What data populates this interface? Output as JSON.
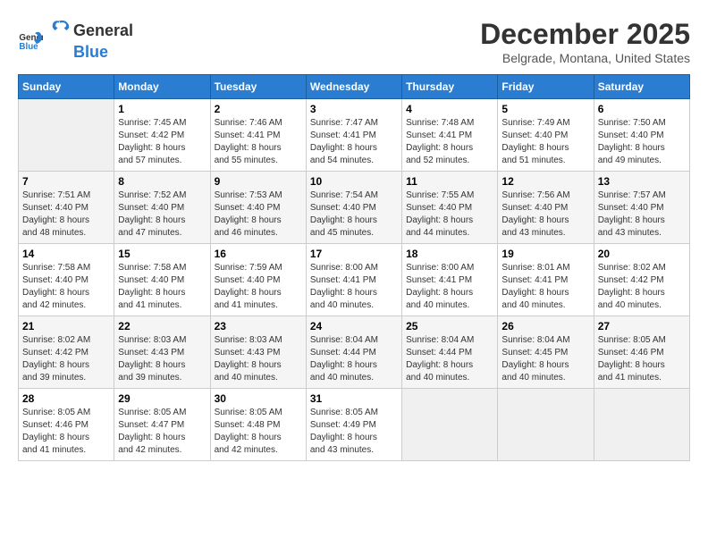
{
  "header": {
    "logo_general": "General",
    "logo_blue": "Blue",
    "month_title": "December 2025",
    "location": "Belgrade, Montana, United States"
  },
  "weekdays": [
    "Sunday",
    "Monday",
    "Tuesday",
    "Wednesday",
    "Thursday",
    "Friday",
    "Saturday"
  ],
  "weeks": [
    [
      {
        "day": "",
        "sunrise": "",
        "sunset": "",
        "daylight": ""
      },
      {
        "day": "1",
        "sunrise": "Sunrise: 7:45 AM",
        "sunset": "Sunset: 4:42 PM",
        "daylight": "Daylight: 8 hours and 57 minutes."
      },
      {
        "day": "2",
        "sunrise": "Sunrise: 7:46 AM",
        "sunset": "Sunset: 4:41 PM",
        "daylight": "Daylight: 8 hours and 55 minutes."
      },
      {
        "day": "3",
        "sunrise": "Sunrise: 7:47 AM",
        "sunset": "Sunset: 4:41 PM",
        "daylight": "Daylight: 8 hours and 54 minutes."
      },
      {
        "day": "4",
        "sunrise": "Sunrise: 7:48 AM",
        "sunset": "Sunset: 4:41 PM",
        "daylight": "Daylight: 8 hours and 52 minutes."
      },
      {
        "day": "5",
        "sunrise": "Sunrise: 7:49 AM",
        "sunset": "Sunset: 4:40 PM",
        "daylight": "Daylight: 8 hours and 51 minutes."
      },
      {
        "day": "6",
        "sunrise": "Sunrise: 7:50 AM",
        "sunset": "Sunset: 4:40 PM",
        "daylight": "Daylight: 8 hours and 49 minutes."
      }
    ],
    [
      {
        "day": "7",
        "sunrise": "Sunrise: 7:51 AM",
        "sunset": "Sunset: 4:40 PM",
        "daylight": "Daylight: 8 hours and 48 minutes."
      },
      {
        "day": "8",
        "sunrise": "Sunrise: 7:52 AM",
        "sunset": "Sunset: 4:40 PM",
        "daylight": "Daylight: 8 hours and 47 minutes."
      },
      {
        "day": "9",
        "sunrise": "Sunrise: 7:53 AM",
        "sunset": "Sunset: 4:40 PM",
        "daylight": "Daylight: 8 hours and 46 minutes."
      },
      {
        "day": "10",
        "sunrise": "Sunrise: 7:54 AM",
        "sunset": "Sunset: 4:40 PM",
        "daylight": "Daylight: 8 hours and 45 minutes."
      },
      {
        "day": "11",
        "sunrise": "Sunrise: 7:55 AM",
        "sunset": "Sunset: 4:40 PM",
        "daylight": "Daylight: 8 hours and 44 minutes."
      },
      {
        "day": "12",
        "sunrise": "Sunrise: 7:56 AM",
        "sunset": "Sunset: 4:40 PM",
        "daylight": "Daylight: 8 hours and 43 minutes."
      },
      {
        "day": "13",
        "sunrise": "Sunrise: 7:57 AM",
        "sunset": "Sunset: 4:40 PM",
        "daylight": "Daylight: 8 hours and 43 minutes."
      }
    ],
    [
      {
        "day": "14",
        "sunrise": "Sunrise: 7:58 AM",
        "sunset": "Sunset: 4:40 PM",
        "daylight": "Daylight: 8 hours and 42 minutes."
      },
      {
        "day": "15",
        "sunrise": "Sunrise: 7:58 AM",
        "sunset": "Sunset: 4:40 PM",
        "daylight": "Daylight: 8 hours and 41 minutes."
      },
      {
        "day": "16",
        "sunrise": "Sunrise: 7:59 AM",
        "sunset": "Sunset: 4:40 PM",
        "daylight": "Daylight: 8 hours and 41 minutes."
      },
      {
        "day": "17",
        "sunrise": "Sunrise: 8:00 AM",
        "sunset": "Sunset: 4:41 PM",
        "daylight": "Daylight: 8 hours and 40 minutes."
      },
      {
        "day": "18",
        "sunrise": "Sunrise: 8:00 AM",
        "sunset": "Sunset: 4:41 PM",
        "daylight": "Daylight: 8 hours and 40 minutes."
      },
      {
        "day": "19",
        "sunrise": "Sunrise: 8:01 AM",
        "sunset": "Sunset: 4:41 PM",
        "daylight": "Daylight: 8 hours and 40 minutes."
      },
      {
        "day": "20",
        "sunrise": "Sunrise: 8:02 AM",
        "sunset": "Sunset: 4:42 PM",
        "daylight": "Daylight: 8 hours and 40 minutes."
      }
    ],
    [
      {
        "day": "21",
        "sunrise": "Sunrise: 8:02 AM",
        "sunset": "Sunset: 4:42 PM",
        "daylight": "Daylight: 8 hours and 39 minutes."
      },
      {
        "day": "22",
        "sunrise": "Sunrise: 8:03 AM",
        "sunset": "Sunset: 4:43 PM",
        "daylight": "Daylight: 8 hours and 39 minutes."
      },
      {
        "day": "23",
        "sunrise": "Sunrise: 8:03 AM",
        "sunset": "Sunset: 4:43 PM",
        "daylight": "Daylight: 8 hours and 40 minutes."
      },
      {
        "day": "24",
        "sunrise": "Sunrise: 8:04 AM",
        "sunset": "Sunset: 4:44 PM",
        "daylight": "Daylight: 8 hours and 40 minutes."
      },
      {
        "day": "25",
        "sunrise": "Sunrise: 8:04 AM",
        "sunset": "Sunset: 4:44 PM",
        "daylight": "Daylight: 8 hours and 40 minutes."
      },
      {
        "day": "26",
        "sunrise": "Sunrise: 8:04 AM",
        "sunset": "Sunset: 4:45 PM",
        "daylight": "Daylight: 8 hours and 40 minutes."
      },
      {
        "day": "27",
        "sunrise": "Sunrise: 8:05 AM",
        "sunset": "Sunset: 4:46 PM",
        "daylight": "Daylight: 8 hours and 41 minutes."
      }
    ],
    [
      {
        "day": "28",
        "sunrise": "Sunrise: 8:05 AM",
        "sunset": "Sunset: 4:46 PM",
        "daylight": "Daylight: 8 hours and 41 minutes."
      },
      {
        "day": "29",
        "sunrise": "Sunrise: 8:05 AM",
        "sunset": "Sunset: 4:47 PM",
        "daylight": "Daylight: 8 hours and 42 minutes."
      },
      {
        "day": "30",
        "sunrise": "Sunrise: 8:05 AM",
        "sunset": "Sunset: 4:48 PM",
        "daylight": "Daylight: 8 hours and 42 minutes."
      },
      {
        "day": "31",
        "sunrise": "Sunrise: 8:05 AM",
        "sunset": "Sunset: 4:49 PM",
        "daylight": "Daylight: 8 hours and 43 minutes."
      },
      {
        "day": "",
        "sunrise": "",
        "sunset": "",
        "daylight": ""
      },
      {
        "day": "",
        "sunrise": "",
        "sunset": "",
        "daylight": ""
      },
      {
        "day": "",
        "sunrise": "",
        "sunset": "",
        "daylight": ""
      }
    ]
  ]
}
